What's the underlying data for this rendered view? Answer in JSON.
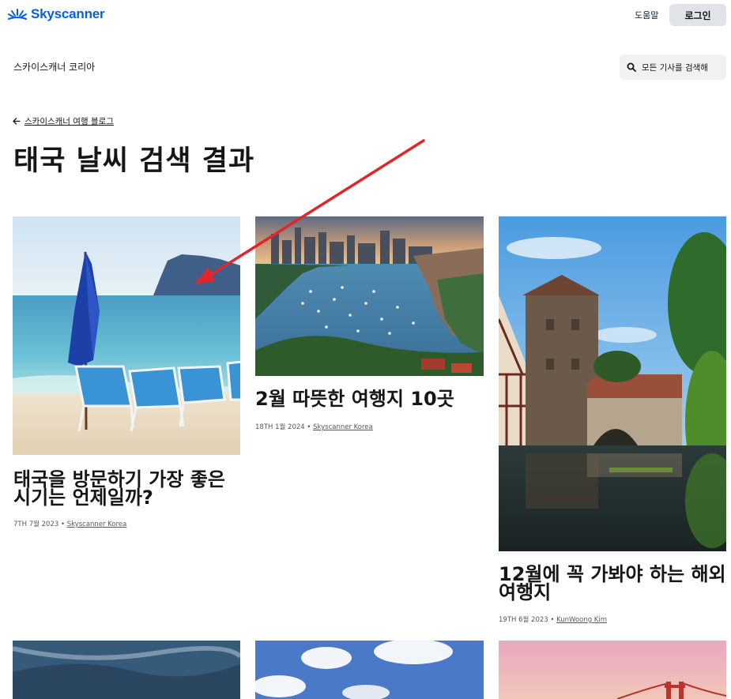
{
  "header": {
    "brand": "Skyscanner",
    "brand_color": "#0062e3",
    "help_label": "도움말",
    "login_label": "로그인"
  },
  "subheader": {
    "site_title": "스카이스캐너 코리아",
    "search_label": "모든 기사를 검색해",
    "search_icon": "search-icon"
  },
  "breadcrumb": {
    "back_icon": "arrow-left-icon",
    "label": "스카이스캐너 여행 블로그"
  },
  "page": {
    "title": "태국 날씨 검색 결과"
  },
  "articles": [
    {
      "title": "태국을 방문하기 가장 좋은 시기는 언제일까?",
      "date": "7TH 7월 2023",
      "separator": "•",
      "author": "Skyscanner Korea",
      "image": "beach-umbrella-chairs"
    },
    {
      "title": "2월 따뜻한 여행지 10곳",
      "date": "18TH 1월 2024",
      "separator": "•",
      "author": "Skyscanner Korea",
      "image": "sydney-harbour"
    },
    {
      "title": "12월에 꼭 가봐야 하는 해외여행지",
      "date": "19TH 6월 2023",
      "separator": "•",
      "author": "KunWoong Kim",
      "image": "nuremberg-tower-river"
    }
  ],
  "annotation": {
    "type": "arrow",
    "color": "#e0262b"
  }
}
